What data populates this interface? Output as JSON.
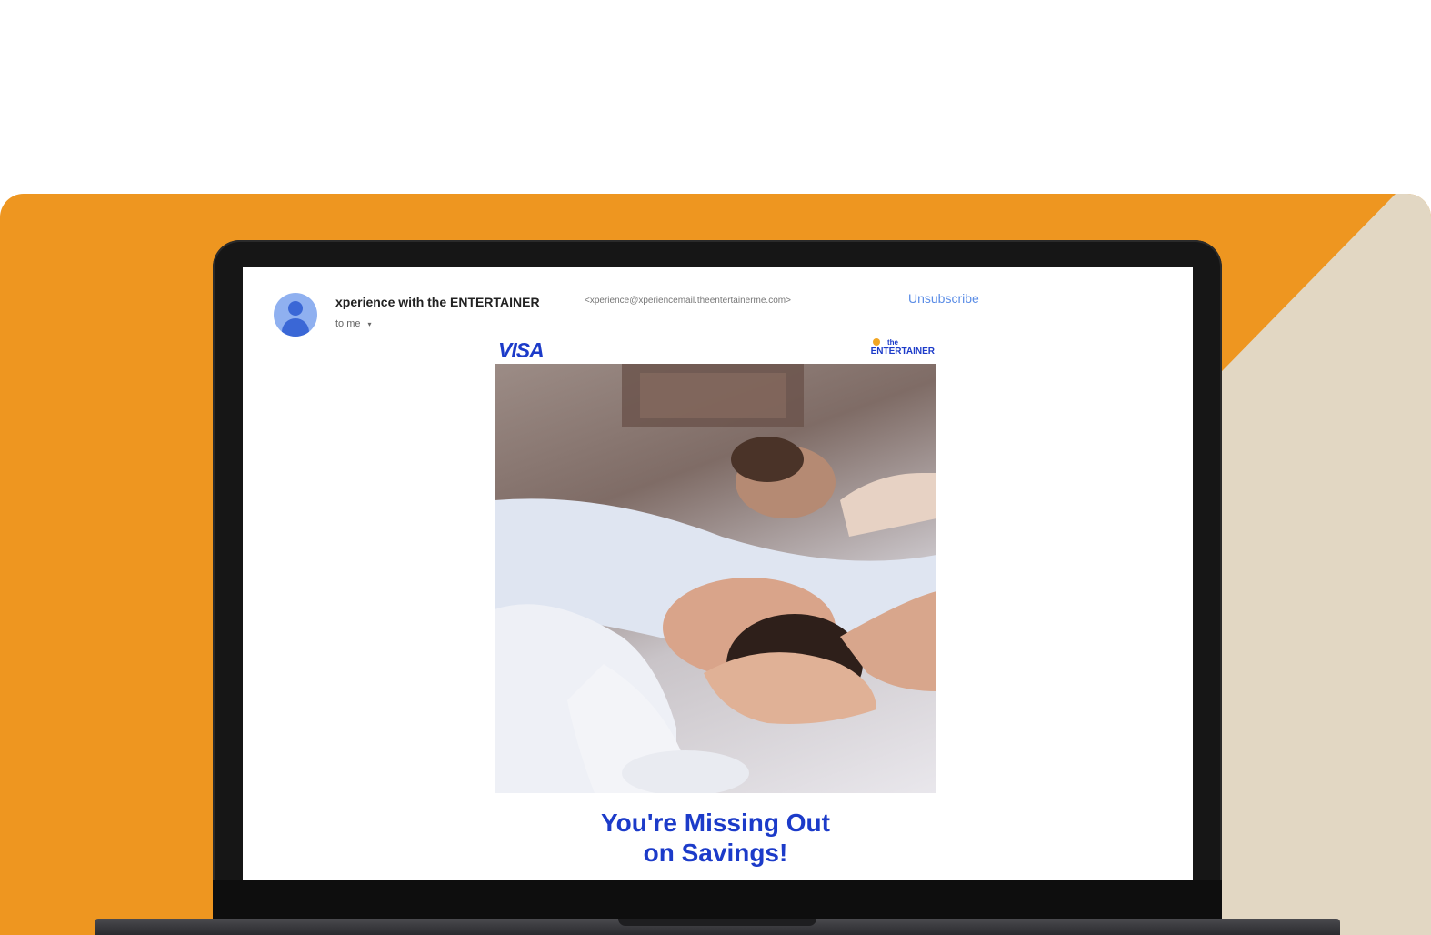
{
  "email": {
    "sender_name": "xperience with the ENTERTAINER",
    "sender_email": "<xperience@xperiencemail.theentertainerme.com>",
    "unsubscribe_label": "Unsubscribe",
    "recipient_label": "to me",
    "recipient_caret": "▾"
  },
  "banner": {
    "visa_logo": "VISA",
    "entertainer_logo_top": "the",
    "entertainer_logo_name": "ENTERTAINER"
  },
  "headline": {
    "line1": "You're Missing Out",
    "line2": "on Savings!"
  },
  "colors": {
    "orange_bg": "#EE9620",
    "beige_bg": "#E2D7C3",
    "brand_blue": "#1C3BC9",
    "link_blue": "#5B8DE6"
  },
  "icons": {
    "avatar": "person-avatar-icon",
    "caret": "chevron-down-icon"
  }
}
